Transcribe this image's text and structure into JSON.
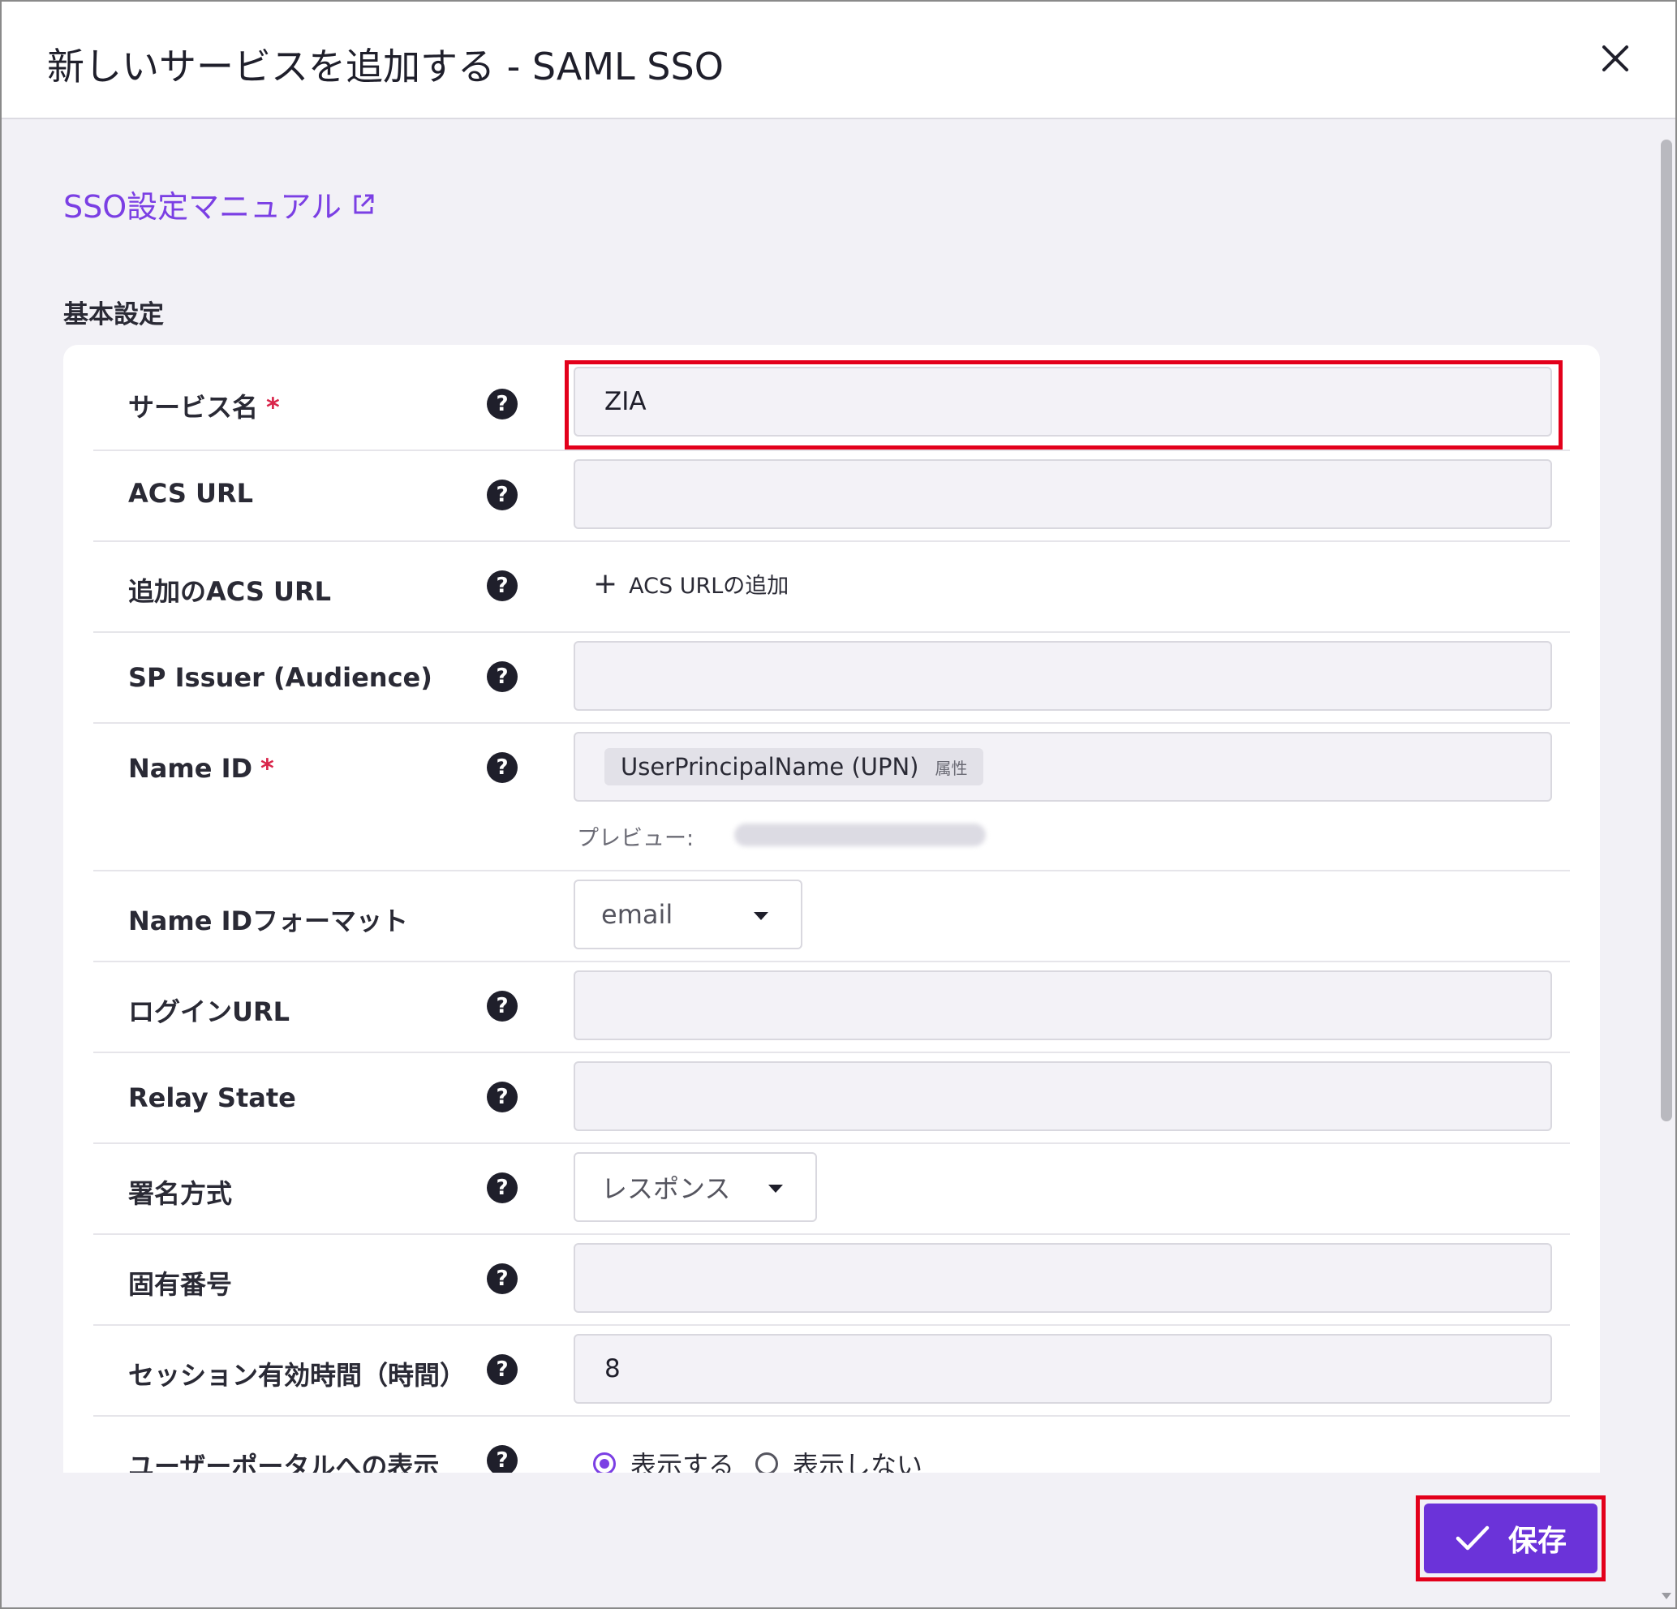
{
  "dialog": {
    "title": "新しいサービスを追加する - SAML SSO",
    "close_label": "×"
  },
  "manual_link": {
    "label": "SSO設定マニュアル"
  },
  "section": {
    "title": "基本設定"
  },
  "fields": {
    "service_name": {
      "label": "サービス名",
      "required": "*",
      "value": "ZIA"
    },
    "acs_url": {
      "label": "ACS URL",
      "value": ""
    },
    "additional_acs_url": {
      "label": "追加のACS URL",
      "add_label": "ACS URLの追加"
    },
    "sp_issuer": {
      "label": "SP Issuer (Audience)",
      "value": ""
    },
    "name_id": {
      "label": "Name ID",
      "required": "*",
      "chip_value": "UserPrincipalName (UPN)",
      "chip_tag": "属性",
      "preview_label": "プレビュー:"
    },
    "name_id_format": {
      "label": "Name IDフォーマット",
      "selected": "email"
    },
    "login_url": {
      "label": "ログインURL",
      "value": ""
    },
    "relay_state": {
      "label": "Relay State",
      "value": ""
    },
    "signature_method": {
      "label": "署名方式",
      "selected": "レスポンス"
    },
    "unique_number": {
      "label": "固有番号",
      "value": ""
    },
    "session_duration": {
      "label": "セッション有効時間（時間）",
      "value": "8"
    },
    "user_portal_display": {
      "label": "ユーザーポータルへの表示",
      "option_show": "表示する",
      "option_hide": "表示しない"
    }
  },
  "footer": {
    "save_label": "保存"
  },
  "colors": {
    "accent": "#7b3fe4",
    "save_button": "#6b33d9",
    "highlight": "#e3001b",
    "required": "#d9254a"
  },
  "help_glyph": "?"
}
